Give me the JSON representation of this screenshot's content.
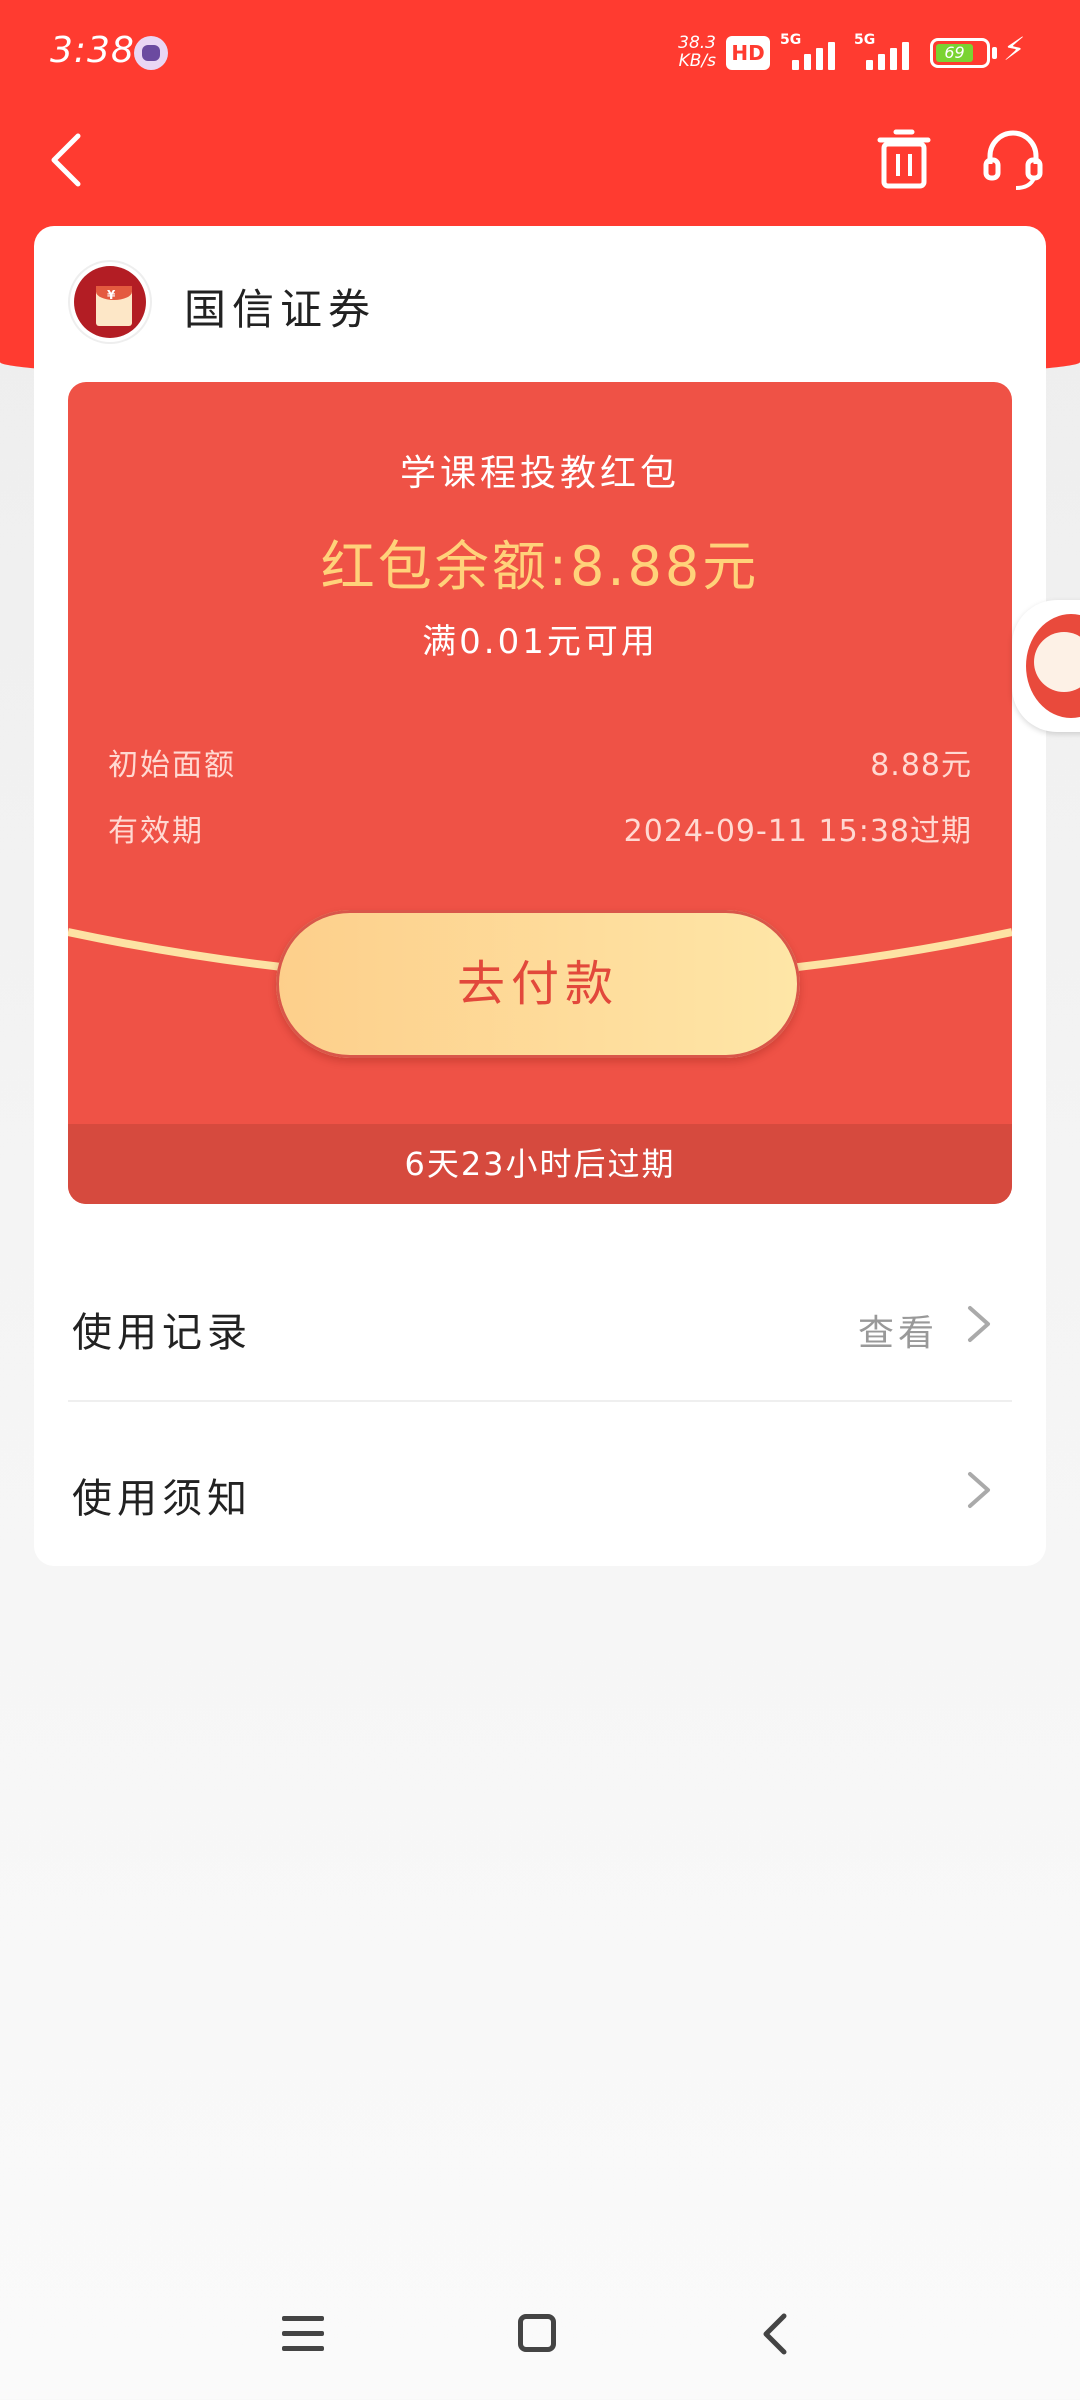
{
  "status_bar": {
    "time": "3:38",
    "net_speed_value": "38.3",
    "net_speed_unit": "KB/s",
    "hd_label": "HD",
    "sim1_type": "5G",
    "sim2_type": "5G",
    "battery": "69"
  },
  "header": {
    "back_icon": "chevron-left-icon",
    "trash_icon": "trash-icon",
    "support_icon": "headset-icon"
  },
  "merchant": {
    "name": "国信证券",
    "icon": "red-envelope-icon"
  },
  "red_packet": {
    "title": "学课程投教红包",
    "balance": "红包余额:8.88元",
    "condition": "满0.01元可用",
    "initial_label": "初始面额",
    "initial_value": "8.88元",
    "validity_label": "有效期",
    "validity_value": "2024-09-11 15:38过期",
    "pay_button": "去付款",
    "expire_countdown": "6天23小时后过期",
    "colors": {
      "packet_bg": "#ef5246",
      "balance_text": "#ffd27a",
      "button_bg": "#fee6a7",
      "button_text": "#e2483b"
    }
  },
  "links": [
    {
      "label": "使用记录",
      "action": "查看"
    },
    {
      "label": "使用须知",
      "action": ""
    }
  ],
  "bottom_nav": {
    "menu_icon": "menu-icon",
    "home_icon": "home-square-icon",
    "back_icon": "back-triangle-icon"
  },
  "theme": {
    "primary": "#ff3b30"
  }
}
